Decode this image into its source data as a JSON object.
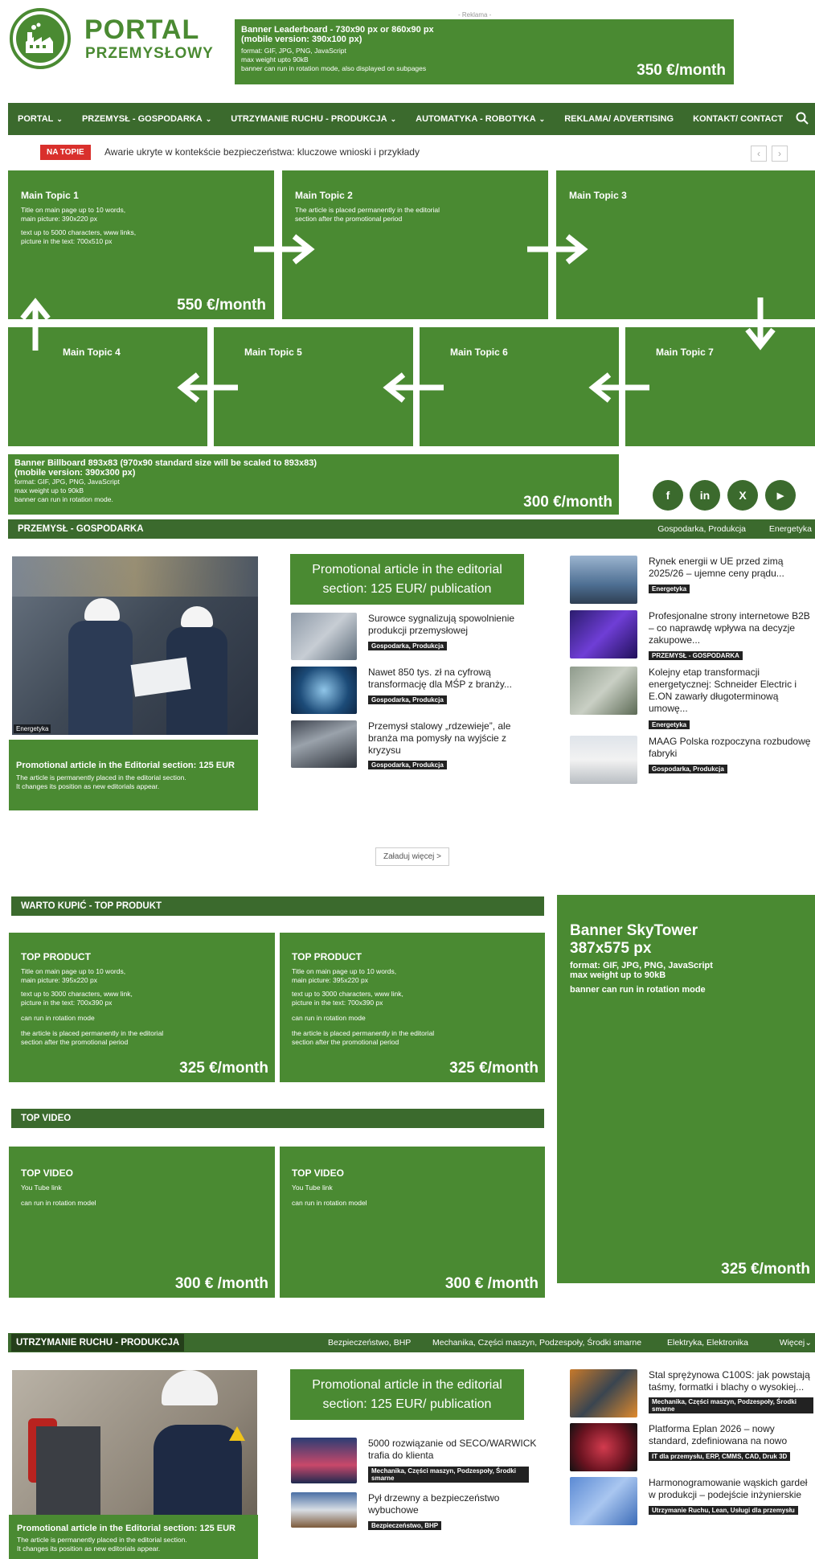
{
  "header": {
    "logo_line1": "PORTAL",
    "logo_line2": "PRZEMYSŁOWY",
    "ad_label": "- Reklama -",
    "leaderboard": {
      "title": "Banner Leaderboard - 730x90 px or 860x90 px",
      "subtitle": "(mobile version: 390x100 px)",
      "line1": "format: GIF, JPG, PNG, JavaScript",
      "line2": "max weight upto 90kB",
      "line3": "banner can run in rotation mode, also displayed on subpages",
      "price": "350 €/month"
    }
  },
  "nav": {
    "items": [
      {
        "label": "PORTAL",
        "chev": "⌄"
      },
      {
        "label": "PRZEMYSŁ - GOSPODARKA",
        "chev": "⌄"
      },
      {
        "label": "UTRZYMANIE RUCHU - PRODUKCJA",
        "chev": "⌄"
      },
      {
        "label": "AUTOMATYKA - ROBOTYKA",
        "chev": "⌄"
      },
      {
        "label": "REKLAMA/ ADVERTISING",
        "chev": ""
      },
      {
        "label": "KONTAKT/ CONTACT",
        "chev": ""
      }
    ]
  },
  "ticker": {
    "badge": "NA TOPIE",
    "text": "Awarie ukryte w kontekście bezpieczeństwa: kluczowe wnioski i przykłady",
    "prev": "‹",
    "next": "›"
  },
  "topics": {
    "t1": {
      "title": "Main Topic 1",
      "l1": "Title on main page up to 10 words,",
      "l2": "main picture: 390x220 px",
      "l3": "text up to 5000 characters, www links,",
      "l4": "picture in the text: 700x510 px",
      "price": "550 €/month"
    },
    "t2": {
      "title": "Main Topic 2",
      "l1": "The article is placed permanently in the editorial",
      "l2": "section after the promotional period"
    },
    "t3": {
      "title": "Main Topic 3"
    },
    "t4": {
      "title": "Main Topic 4"
    },
    "t5": {
      "title": "Main Topic 5"
    },
    "t6": {
      "title": "Main Topic 6"
    },
    "t7": {
      "title": "Main Topic 7"
    }
  },
  "billboard": {
    "title": "Banner Billboard 893x83 (970x90 standard size will be scaled to 893x83)",
    "subtitle": "(mobile version: 390x300 px)",
    "l1": "format: GIF, JPG, PNG, JavaScript",
    "l2": "max weight up to 90kB",
    "l3": "banner can run in rotation mode.",
    "price": "300 €/month"
  },
  "social": [
    "f",
    "in",
    "X",
    "▶"
  ],
  "section1": {
    "title": "PRZEMYSŁ - GOSPODARKA",
    "links": [
      "Gospodarka, Produkcja",
      "Energetyka"
    ],
    "main_image_tag": "Energetyka",
    "promo_left": {
      "title": "Promotional article in the Editorial section: 125 EUR",
      "l1": "The article is permanently placed in the editorial section.",
      "l2": "It changes its position as new editorials appear."
    },
    "promo_mid": "Promotional article in the editorial section: 125 EUR/ publication",
    "mid_articles": [
      {
        "title": "Surowce sygnalizują spowolnienie produkcji przemysłowej",
        "tag": "Gospodarka, Produkcja"
      },
      {
        "title": "Nawet 850 tys. zł na cyfrową transformację dla MŚP z branży...",
        "tag": "Gospodarka, Produkcja"
      },
      {
        "title": "Przemysł stalowy „rdzewieje”, ale branża ma pomysły na wyjście z kryzysu",
        "tag": "Gospodarka, Produkcja"
      }
    ],
    "right_articles": [
      {
        "title": "Rynek energii w UE przed zimą 2025/26 – ujemne ceny prądu...",
        "tag": "Energetyka"
      },
      {
        "title": "Profesjonalne strony internetowe B2B – co naprawdę wpływa na decyzje zakupowe...",
        "tag": "PRZEMYSŁ - GOSPODARKA"
      },
      {
        "title": "Kolejny etap transformacji energetycznej: Schneider Electric i E.ON zawarły długoterminową umowę...",
        "tag": "Energetyka"
      },
      {
        "title": "MAAG Polska rozpoczyna rozbudowę fabryki",
        "tag": "Gospodarka, Produkcja"
      }
    ],
    "load_more": "Załaduj więcej >"
  },
  "buy": {
    "title": "WARTO KUPIĆ - TOP PRODUKT",
    "cards": [
      {
        "title": "TOP PRODUCT",
        "l1": "Title on main page up to 10 words,",
        "l2": "main picture: 395x220 px",
        "l3": "text up to 3000 characters, www link,",
        "l4": "picture in the text: 700x390 px",
        "l5": "can run in rotation mode",
        "l6": "the article is placed permanently in the editorial",
        "l7": "section after the promotional period",
        "price": "325 €/month"
      },
      {
        "title": "TOP PRODUCT",
        "l1": "Title on main page up to 10 words,",
        "l2": "main picture: 395x220 px",
        "l3": "text up to 3000 characters, www link,",
        "l4": "picture in the text: 700x390 px",
        "l5": "can run in rotation mode",
        "l6": "the article is placed permanently in the editorial",
        "l7": "section after the promotional period",
        "price": "325 €/month"
      }
    ]
  },
  "skytower": {
    "title1": "Banner SkyTower",
    "title2": "387x575 px",
    "l1": "format: GIF, JPG, PNG, JavaScript",
    "l2": "max weight up to 90kB",
    "l3": "banner can run in rotation mode",
    "price": "325 €/month"
  },
  "video": {
    "title": "TOP VIDEO",
    "cards": [
      {
        "title": "TOP VIDEO",
        "l1": "You Tube link",
        "l2": "can run in rotation model",
        "price": "300 € /month"
      },
      {
        "title": "TOP VIDEO",
        "l1": "You Tube link",
        "l2": "can run in rotation model",
        "price": "300 € /month"
      }
    ]
  },
  "section2": {
    "title": "UTRZYMANIE RUCHU - PRODUKCJA",
    "links": [
      "Bezpieczeństwo, BHP",
      "Mechanika, Części maszyn, Podzespoły, Środki smarne",
      "Elektryka, Elektronika",
      "Więcej⌄"
    ],
    "promo_mid": "Promotional article in the editorial section: 125 EUR/ publication",
    "promo_left": {
      "title": "Promotional article in the Editorial section: 125 EUR",
      "l1": "The article is permanently placed in the editorial section.",
      "l2": "It changes its position as new editorials appear."
    },
    "mid_articles": [
      {
        "title": "5000 rozwiązanie od SECO/WARWICK trafia do klienta",
        "tag": "Mechanika, Części maszyn, Podzespoły, Środki smarne"
      },
      {
        "title": "Pył drzewny a bezpieczeństwo wybuchowe",
        "tag": "Bezpieczeństwo, BHP"
      }
    ],
    "right_articles": [
      {
        "title": "Stal sprężynowa C100S: jak powstają taśmy, formatki i blachy o wysokiej...",
        "tag": "Mechanika, Części maszyn, Podzespoły, Środki smarne"
      },
      {
        "title": "Platforma Eplan 2026 – nowy standard, zdefiniowana na nowo",
        "tag": "IT dla przemysłu, ERP, CMMS, CAD, Druk 3D"
      },
      {
        "title": "Harmonogramowanie wąskich gardeł w produkcji – podejście inżynierskie",
        "tag": "Utrzymanie Ruchu, Lean, Usługi dla przemysłu"
      }
    ]
  },
  "colors": {
    "brand_green": "#4a8a32",
    "dark_green": "#3b6a2d",
    "badge_red": "#d9302c"
  }
}
